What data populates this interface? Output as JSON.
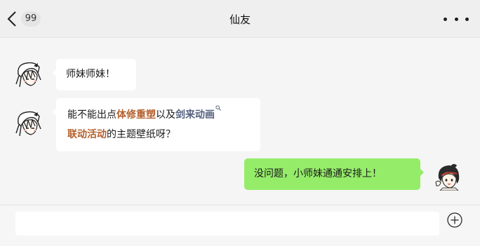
{
  "header": {
    "unread_count": "99",
    "title": "仙友"
  },
  "messages": [
    {
      "direction": "incoming",
      "text": "师妹师妹！"
    },
    {
      "direction": "incoming",
      "parts": {
        "p1": "能不能出点",
        "p2": "体修重塑",
        "p3": "以及",
        "p4": "剑来动画",
        "p5": "联动活动",
        "p6": "的主题壁纸呀？"
      }
    },
    {
      "direction": "outgoing",
      "text": "没问题，小师妹通通安排上！"
    }
  ],
  "composer": {
    "input_value": ""
  },
  "icons": {
    "back": "chevron-left-icon",
    "more": "more-dots-icon",
    "plus": "plus-circle-icon",
    "link_search": "search-icon"
  },
  "colors": {
    "outgoing_bubble": "#95ec69",
    "incoming_bubble": "#ffffff",
    "highlight": "#b45f2c",
    "link": "#54607e",
    "background": "#f5f5f5"
  }
}
